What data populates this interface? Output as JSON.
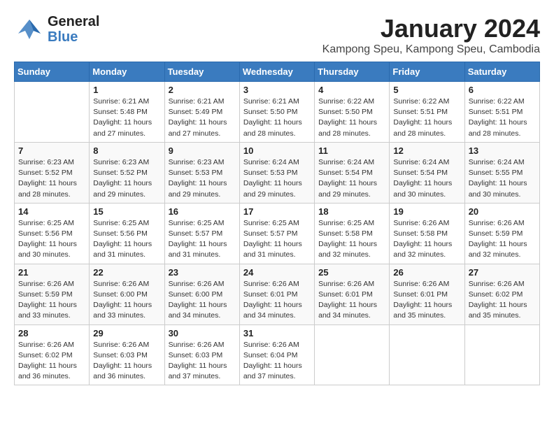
{
  "header": {
    "logo_general": "General",
    "logo_blue": "Blue",
    "title": "January 2024",
    "subtitle": "Kampong Speu, Kampong Speu, Cambodia"
  },
  "calendar": {
    "days_of_week": [
      "Sunday",
      "Monday",
      "Tuesday",
      "Wednesday",
      "Thursday",
      "Friday",
      "Saturday"
    ],
    "weeks": [
      [
        {
          "day": "",
          "info": ""
        },
        {
          "day": "1",
          "info": "Sunrise: 6:21 AM\nSunset: 5:48 PM\nDaylight: 11 hours\nand 27 minutes."
        },
        {
          "day": "2",
          "info": "Sunrise: 6:21 AM\nSunset: 5:49 PM\nDaylight: 11 hours\nand 27 minutes."
        },
        {
          "day": "3",
          "info": "Sunrise: 6:21 AM\nSunset: 5:50 PM\nDaylight: 11 hours\nand 28 minutes."
        },
        {
          "day": "4",
          "info": "Sunrise: 6:22 AM\nSunset: 5:50 PM\nDaylight: 11 hours\nand 28 minutes."
        },
        {
          "day": "5",
          "info": "Sunrise: 6:22 AM\nSunset: 5:51 PM\nDaylight: 11 hours\nand 28 minutes."
        },
        {
          "day": "6",
          "info": "Sunrise: 6:22 AM\nSunset: 5:51 PM\nDaylight: 11 hours\nand 28 minutes."
        }
      ],
      [
        {
          "day": "7",
          "info": "Sunrise: 6:23 AM\nSunset: 5:52 PM\nDaylight: 11 hours\nand 28 minutes."
        },
        {
          "day": "8",
          "info": "Sunrise: 6:23 AM\nSunset: 5:52 PM\nDaylight: 11 hours\nand 29 minutes."
        },
        {
          "day": "9",
          "info": "Sunrise: 6:23 AM\nSunset: 5:53 PM\nDaylight: 11 hours\nand 29 minutes."
        },
        {
          "day": "10",
          "info": "Sunrise: 6:24 AM\nSunset: 5:53 PM\nDaylight: 11 hours\nand 29 minutes."
        },
        {
          "day": "11",
          "info": "Sunrise: 6:24 AM\nSunset: 5:54 PM\nDaylight: 11 hours\nand 29 minutes."
        },
        {
          "day": "12",
          "info": "Sunrise: 6:24 AM\nSunset: 5:54 PM\nDaylight: 11 hours\nand 30 minutes."
        },
        {
          "day": "13",
          "info": "Sunrise: 6:24 AM\nSunset: 5:55 PM\nDaylight: 11 hours\nand 30 minutes."
        }
      ],
      [
        {
          "day": "14",
          "info": "Sunrise: 6:25 AM\nSunset: 5:56 PM\nDaylight: 11 hours\nand 30 minutes."
        },
        {
          "day": "15",
          "info": "Sunrise: 6:25 AM\nSunset: 5:56 PM\nDaylight: 11 hours\nand 31 minutes."
        },
        {
          "day": "16",
          "info": "Sunrise: 6:25 AM\nSunset: 5:57 PM\nDaylight: 11 hours\nand 31 minutes."
        },
        {
          "day": "17",
          "info": "Sunrise: 6:25 AM\nSunset: 5:57 PM\nDaylight: 11 hours\nand 31 minutes."
        },
        {
          "day": "18",
          "info": "Sunrise: 6:25 AM\nSunset: 5:58 PM\nDaylight: 11 hours\nand 32 minutes."
        },
        {
          "day": "19",
          "info": "Sunrise: 6:26 AM\nSunset: 5:58 PM\nDaylight: 11 hours\nand 32 minutes."
        },
        {
          "day": "20",
          "info": "Sunrise: 6:26 AM\nSunset: 5:59 PM\nDaylight: 11 hours\nand 32 minutes."
        }
      ],
      [
        {
          "day": "21",
          "info": "Sunrise: 6:26 AM\nSunset: 5:59 PM\nDaylight: 11 hours\nand 33 minutes."
        },
        {
          "day": "22",
          "info": "Sunrise: 6:26 AM\nSunset: 6:00 PM\nDaylight: 11 hours\nand 33 minutes."
        },
        {
          "day": "23",
          "info": "Sunrise: 6:26 AM\nSunset: 6:00 PM\nDaylight: 11 hours\nand 34 minutes."
        },
        {
          "day": "24",
          "info": "Sunrise: 6:26 AM\nSunset: 6:01 PM\nDaylight: 11 hours\nand 34 minutes."
        },
        {
          "day": "25",
          "info": "Sunrise: 6:26 AM\nSunset: 6:01 PM\nDaylight: 11 hours\nand 34 minutes."
        },
        {
          "day": "26",
          "info": "Sunrise: 6:26 AM\nSunset: 6:01 PM\nDaylight: 11 hours\nand 35 minutes."
        },
        {
          "day": "27",
          "info": "Sunrise: 6:26 AM\nSunset: 6:02 PM\nDaylight: 11 hours\nand 35 minutes."
        }
      ],
      [
        {
          "day": "28",
          "info": "Sunrise: 6:26 AM\nSunset: 6:02 PM\nDaylight: 11 hours\nand 36 minutes."
        },
        {
          "day": "29",
          "info": "Sunrise: 6:26 AM\nSunset: 6:03 PM\nDaylight: 11 hours\nand 36 minutes."
        },
        {
          "day": "30",
          "info": "Sunrise: 6:26 AM\nSunset: 6:03 PM\nDaylight: 11 hours\nand 37 minutes."
        },
        {
          "day": "31",
          "info": "Sunrise: 6:26 AM\nSunset: 6:04 PM\nDaylight: 11 hours\nand 37 minutes."
        },
        {
          "day": "",
          "info": ""
        },
        {
          "day": "",
          "info": ""
        },
        {
          "day": "",
          "info": ""
        }
      ]
    ]
  }
}
